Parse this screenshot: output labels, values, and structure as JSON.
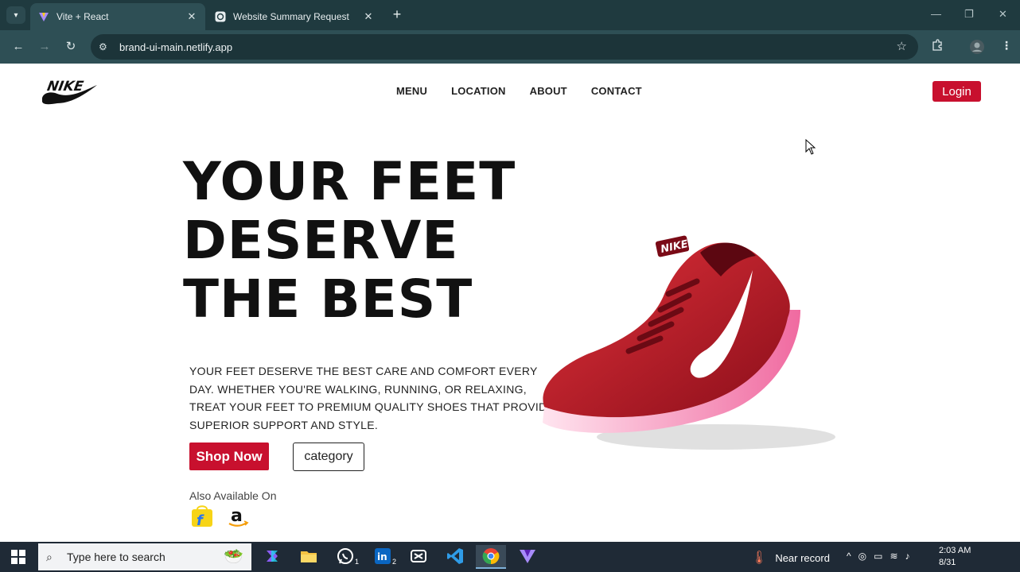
{
  "browser": {
    "tabs": [
      {
        "title": "Vite + React",
        "active": true
      },
      {
        "title": "Website Summary Request",
        "active": false
      }
    ],
    "url": "brand-ui-main.netlify.app"
  },
  "site": {
    "logo_text": "NIKE",
    "nav": [
      "MENU",
      "LOCATION",
      "ABOUT",
      "CONTACT"
    ],
    "login_label": "Login",
    "hero_lines": [
      "YOUR FEET",
      "DESERVE",
      "THE BEST"
    ],
    "description": "YOUR FEET DESERVE THE BEST CARE AND COMFORT EVERY DAY. WHETHER YOU'RE WALKING, RUNNING, OR RELAXING, TREAT YOUR FEET TO PREMIUM QUALITY SHOES THAT PROVIDE SUPERIOR SUPPORT AND STYLE.",
    "shop_now_label": "Shop Now",
    "category_label": "category",
    "also_available": "Also Available On",
    "stores": [
      "flipkart-icon",
      "amazon-icon"
    ],
    "shoe_brand": "NIKE",
    "accent_color": "#c8102e"
  },
  "taskbar": {
    "search_placeholder": "Type here to search",
    "weather": "Near record",
    "time": "2:03 AM",
    "date": "8/31",
    "apps": [
      {
        "name": "copilot-icon",
        "badge": ""
      },
      {
        "name": "file-explorer-icon",
        "badge": ""
      },
      {
        "name": "whatsapp-icon",
        "badge": "1"
      },
      {
        "name": "linkedin-icon",
        "badge": "2"
      },
      {
        "name": "capcut-icon",
        "badge": ""
      },
      {
        "name": "vscode-icon",
        "badge": ""
      },
      {
        "name": "chrome-icon",
        "badge": ""
      },
      {
        "name": "vite-icon",
        "badge": ""
      }
    ]
  }
}
